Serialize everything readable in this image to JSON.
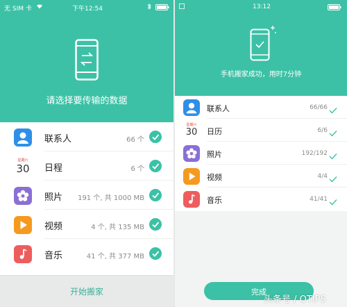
{
  "left": {
    "status": {
      "carrier": "无 SIM 卡",
      "time": "下午12:54"
    },
    "title": "请选择要传输的数据",
    "items": [
      {
        "name": "联系人",
        "meta": "66 个"
      },
      {
        "name": "日程",
        "meta": "6 个",
        "cal_weekday": "星期六",
        "cal_day": "30"
      },
      {
        "name": "照片",
        "meta": "191 个, 共 1000 MB"
      },
      {
        "name": "视频",
        "meta": "4 个, 共 135 MB"
      },
      {
        "name": "音乐",
        "meta": "41 个, 共 377 MB"
      }
    ],
    "button": "开始搬家"
  },
  "right": {
    "status": {
      "time": "13:12"
    },
    "title": "手机搬家成功，用时7分钟",
    "items": [
      {
        "name": "联系人",
        "meta": "66/66"
      },
      {
        "name": "日历",
        "meta": "6/6",
        "cal_weekday": "星期六",
        "cal_day": "30"
      },
      {
        "name": "照片",
        "meta": "192/192"
      },
      {
        "name": "视频",
        "meta": "4/4"
      },
      {
        "name": "音乐",
        "meta": "41/41"
      }
    ],
    "button": "完成"
  },
  "watermark": "头条号 / OTIPS",
  "colors": {
    "accent": "#3cc1a6",
    "contacts": "#2f8fe8",
    "photos": "#8a6fd6",
    "videos": "#f59a1e",
    "music": "#ee5d5d"
  }
}
